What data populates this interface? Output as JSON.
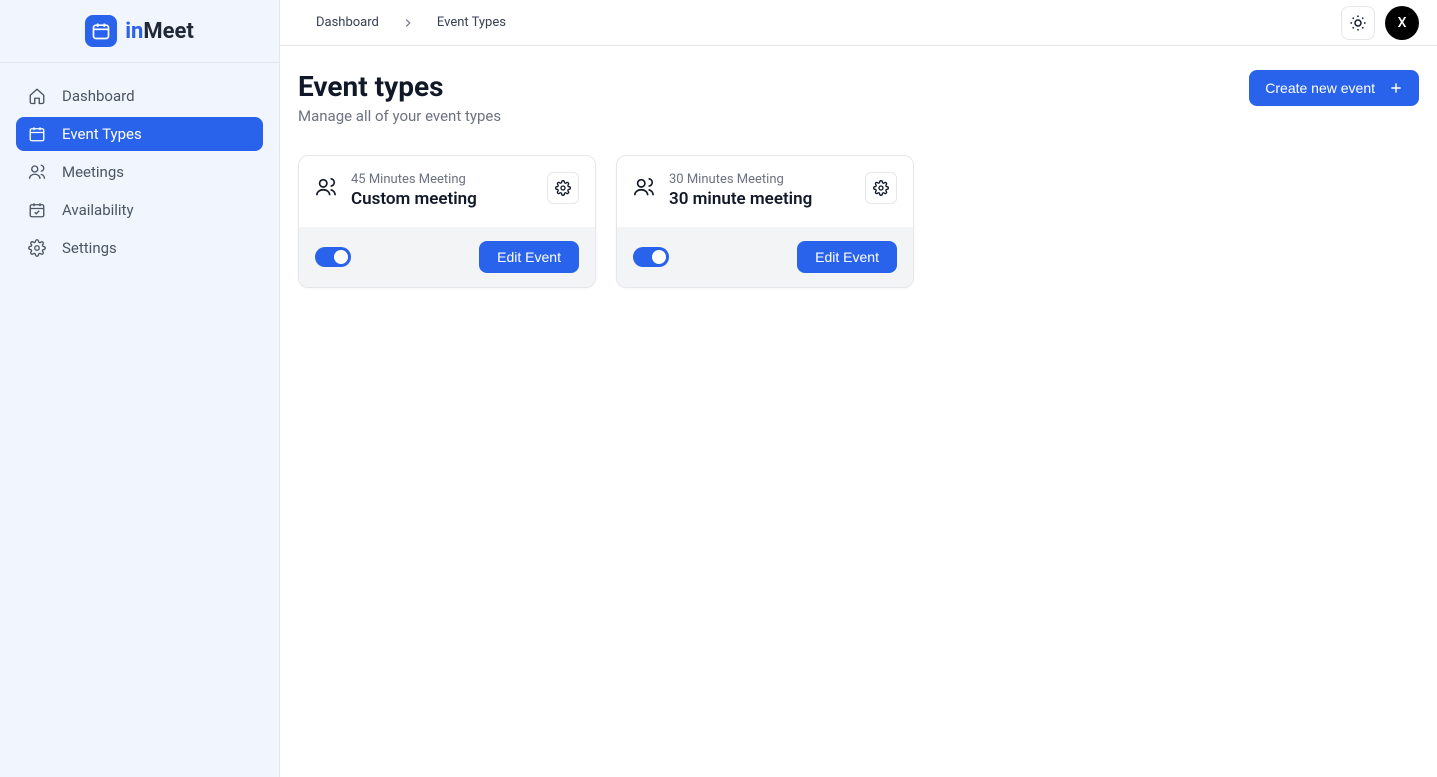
{
  "brand": {
    "prefix": "in",
    "suffix": "Meet"
  },
  "sidebar": {
    "items": [
      {
        "label": "Dashboard",
        "icon": "home"
      },
      {
        "label": "Event Types",
        "icon": "calendar"
      },
      {
        "label": "Meetings",
        "icon": "users"
      },
      {
        "label": "Availability",
        "icon": "calendar-check"
      },
      {
        "label": "Settings",
        "icon": "gear"
      }
    ]
  },
  "breadcrumb": {
    "item0": "Dashboard",
    "item1": "Event Types"
  },
  "user": {
    "initial": "X"
  },
  "page": {
    "title": "Event types",
    "subtitle": "Manage all of your event types",
    "create_label": "Create new event"
  },
  "events": [
    {
      "duration": "45 Minutes Meeting",
      "title": "Custom meeting",
      "enabled": true,
      "edit_label": "Edit Event"
    },
    {
      "duration": "30 Minutes Meeting",
      "title": "30 minute meeting",
      "enabled": true,
      "edit_label": "Edit Event"
    }
  ]
}
